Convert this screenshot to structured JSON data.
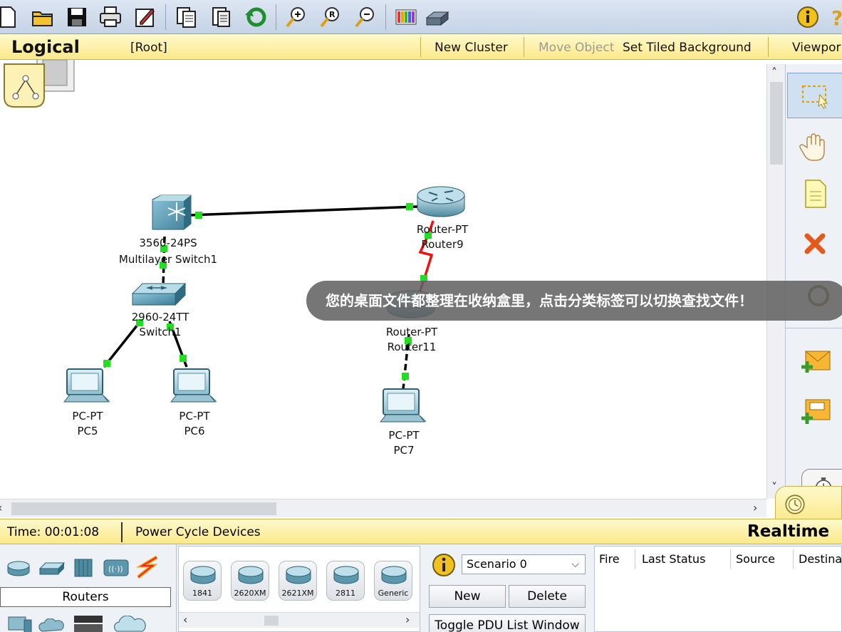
{
  "toolbar": {
    "icons": [
      "new-file-icon",
      "open-folder-icon",
      "save-icon",
      "print-icon",
      "activity-wizard-icon",
      "copy-icon",
      "paste-icon",
      "undo-icon",
      "zoom-in-icon",
      "zoom-reset-icon",
      "zoom-out-icon",
      "palette-icon",
      "custom-device-icon",
      "info-icon",
      "help-icon"
    ]
  },
  "workspace": {
    "mode": "Logical",
    "path": "[Root]",
    "new_cluster": "New Cluster",
    "move_object": "Move Object",
    "set_background": "Set Tiled Background",
    "viewport": "Viewpor"
  },
  "topology": {
    "devices": [
      {
        "id": "msw1",
        "model": "3560-24PS",
        "name": "Multilayer Switch1"
      },
      {
        "id": "r9",
        "model": "Router-PT",
        "name": "Router9"
      },
      {
        "id": "sw1",
        "model": "2960-24TT",
        "name": "Switch1"
      },
      {
        "id": "r11",
        "model": "Router-PT",
        "name": "Router11"
      },
      {
        "id": "pc5",
        "model": "PC-PT",
        "name": "PC5"
      },
      {
        "id": "pc6",
        "model": "PC-PT",
        "name": "PC6"
      },
      {
        "id": "pc7",
        "model": "PC-PT",
        "name": "PC7"
      }
    ],
    "links": [
      {
        "from": "msw1",
        "to": "r9",
        "type": "copper-straight",
        "color": "#000000"
      },
      {
        "from": "msw1",
        "to": "sw1",
        "type": "copper-dashed",
        "color": "#000000"
      },
      {
        "from": "sw1",
        "to": "pc5",
        "type": "copper-straight",
        "color": "#000000"
      },
      {
        "from": "sw1",
        "to": "pc6",
        "type": "copper-straight",
        "color": "#000000"
      },
      {
        "from": "r9",
        "to": "r11",
        "type": "serial",
        "color": "#ee1111"
      },
      {
        "from": "r11",
        "to": "pc7",
        "type": "copper-dashed",
        "color": "#000000"
      }
    ],
    "link_status_color": "#22dd22"
  },
  "palette": {
    "tools": [
      "select-icon",
      "move-hand-icon",
      "note-icon",
      "delete-icon",
      "inspect-icon",
      "simple-pdu-icon",
      "complex-pdu-icon"
    ]
  },
  "status": {
    "time": "Time: 00:01:08",
    "power_cycle": "Power Cycle Devices",
    "mode": "Realtime"
  },
  "device_categories": {
    "selected": "Routers",
    "icons": [
      "routers-icon",
      "switches-icon",
      "hubs-icon",
      "wireless-icon",
      "connections-icon",
      "end-devices-icon",
      "wan-emulation-icon",
      "custom-devices-icon",
      "multiuser-icon"
    ]
  },
  "device_models": [
    "1841",
    "2620XM",
    "2621XM",
    "2811",
    "Generic"
  ],
  "scenario": {
    "selected": "Scenario 0",
    "new_label": "New",
    "delete_label": "Delete",
    "toggle_label": "Toggle PDU List Window"
  },
  "pdu_list": {
    "columns": [
      "Fire",
      "Last Status",
      "Source",
      "Destina"
    ]
  },
  "toast": {
    "message": "您的桌面文件都整理在收纳盒里，点击分类标签可以切换查找文件！"
  }
}
